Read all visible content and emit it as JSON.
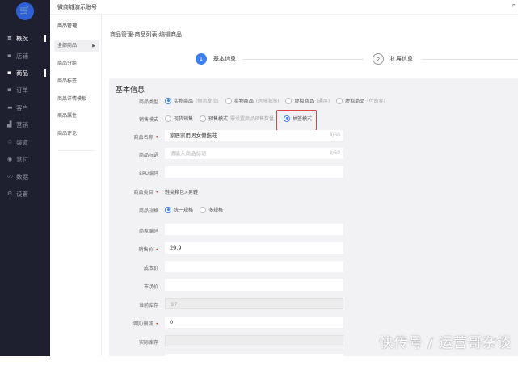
{
  "sidebar": {
    "items": [
      {
        "label": "概况",
        "icon": "≡"
      },
      {
        "label": "店铺",
        "icon": "▪"
      },
      {
        "label": "商品",
        "icon": "▪"
      },
      {
        "label": "订单",
        "icon": "▪"
      },
      {
        "label": "客户",
        "icon": "▬"
      },
      {
        "label": "营销",
        "icon": "▟"
      },
      {
        "label": "渠道",
        "icon": "♲"
      },
      {
        "label": "慧付",
        "icon": "◉"
      },
      {
        "label": "数据",
        "icon": "〰"
      },
      {
        "label": "设置",
        "icon": "⚙"
      }
    ]
  },
  "header": {
    "title": "微商城演示账号"
  },
  "subnav": {
    "title": "商品管理",
    "items": [
      "全部商品",
      "商品分组",
      "商品标签",
      "商品详情模板",
      "商品属性",
      "商品评论"
    ],
    "arrow": "▶"
  },
  "breadcrumb": "商品管理-商品列表-编辑商品",
  "steps": [
    {
      "num": "1",
      "label": "基本信息"
    },
    {
      "num": "2",
      "label": "扩展信息"
    }
  ],
  "form": {
    "section_title": "基本信息",
    "type": {
      "label": "商品类型",
      "options": [
        {
          "label": "实物商品",
          "hint": "(物流发货)"
        },
        {
          "label": "实物商品",
          "hint": "(跨境海淘)"
        },
        {
          "label": "虚拟商品",
          "hint": "(通用)"
        },
        {
          "label": "虚拟商品",
          "hint": "(付费券)"
        }
      ]
    },
    "sale_mode": {
      "label": "销售模式",
      "options": [
        "现货销售",
        "预售模式",
        "抽签模式"
      ],
      "hint": "需设置商品预售数量"
    },
    "name": {
      "label": "商品名称",
      "value": "家居家用男女懒拖鞋",
      "count": "9/60"
    },
    "slogan": {
      "label": "商品标语",
      "placeholder": "请输入商品标语",
      "count": "0/60"
    },
    "spu": {
      "label": "SPU编码",
      "value": ""
    },
    "category": {
      "label": "商品类目",
      "value": "鞋类箱包>男鞋"
    },
    "spec": {
      "label": "商品规格",
      "options": [
        "统一规格",
        "多规格"
      ]
    },
    "merchant_code": {
      "label": "商家编码",
      "value": ""
    },
    "price": {
      "label": "销售价",
      "value": "29.9"
    },
    "cost": {
      "label": "成本价",
      "value": ""
    },
    "market": {
      "label": "市场价",
      "value": ""
    },
    "stock": {
      "label": "当前库存",
      "value": "97"
    },
    "adjust": {
      "label": "增加/删减",
      "value": "0"
    },
    "actual": {
      "label": "实际库存",
      "value": ""
    }
  },
  "required_mark": "•",
  "watermark": "快传号 / 运营哥杂谈"
}
